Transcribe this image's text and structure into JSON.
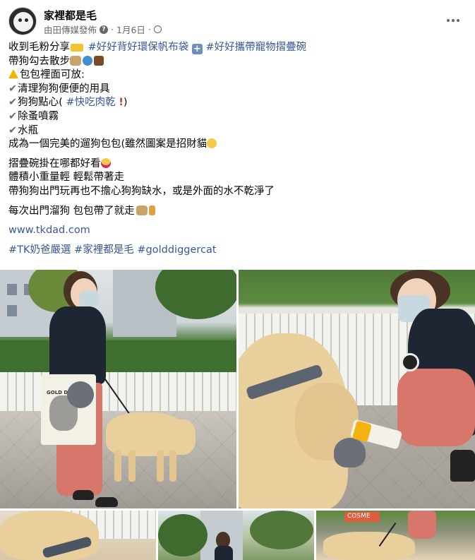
{
  "header": {
    "page_name": "家裡都是毛",
    "author": "由田傳媒發佈",
    "dot": "·",
    "date": "1月6日",
    "dot2": "·",
    "help_icon": "question-icon",
    "privacy_icon": "globe-icon",
    "more_icon": "more-horiz-icon"
  },
  "post": {
    "l1_text": "收到毛粉分享",
    "l1_tag1": "#好好背好環保帆布袋",
    "l1_tag2": "#好好攜帶寵物摺疊碗",
    "l2_text": "帶狗勾去散步",
    "l3_text": "包包裡面可放:",
    "l4_text": "清理狗狗便便的用具",
    "l5_text": "狗狗點心(",
    "l5_tag": "#快吃肉乾",
    "l5_end": ")",
    "l6_text": "除蚤噴霧",
    "l7_text": "水瓶",
    "l8_text": "成為一個完美的遛狗包包(雖然圖案是招財貓",
    "l9_text": "摺疊碗掛在哪都好看",
    "l10_text": "體積小重量輕 輕鬆帶著走",
    "l11_text": "帶狗狗出門玩再也不擔心狗狗缺水，或是外面的水不乾淨了",
    "l12_text": "每次出門溜狗 包包帶了就走",
    "link": "www.tkdad.com",
    "hashtags": [
      "#TK奶爸嚴選",
      "#家裡都是毛",
      "#golddiggercat"
    ],
    "check_mark": "✔",
    "plus_mark": "+",
    "exclaim_mark": "!"
  },
  "photos": {
    "bag_print": "GOLD DIGGER",
    "shop_sign": "COSME"
  },
  "colors": {
    "link": "#385898",
    "text": "#050505",
    "meta": "#65676b"
  }
}
